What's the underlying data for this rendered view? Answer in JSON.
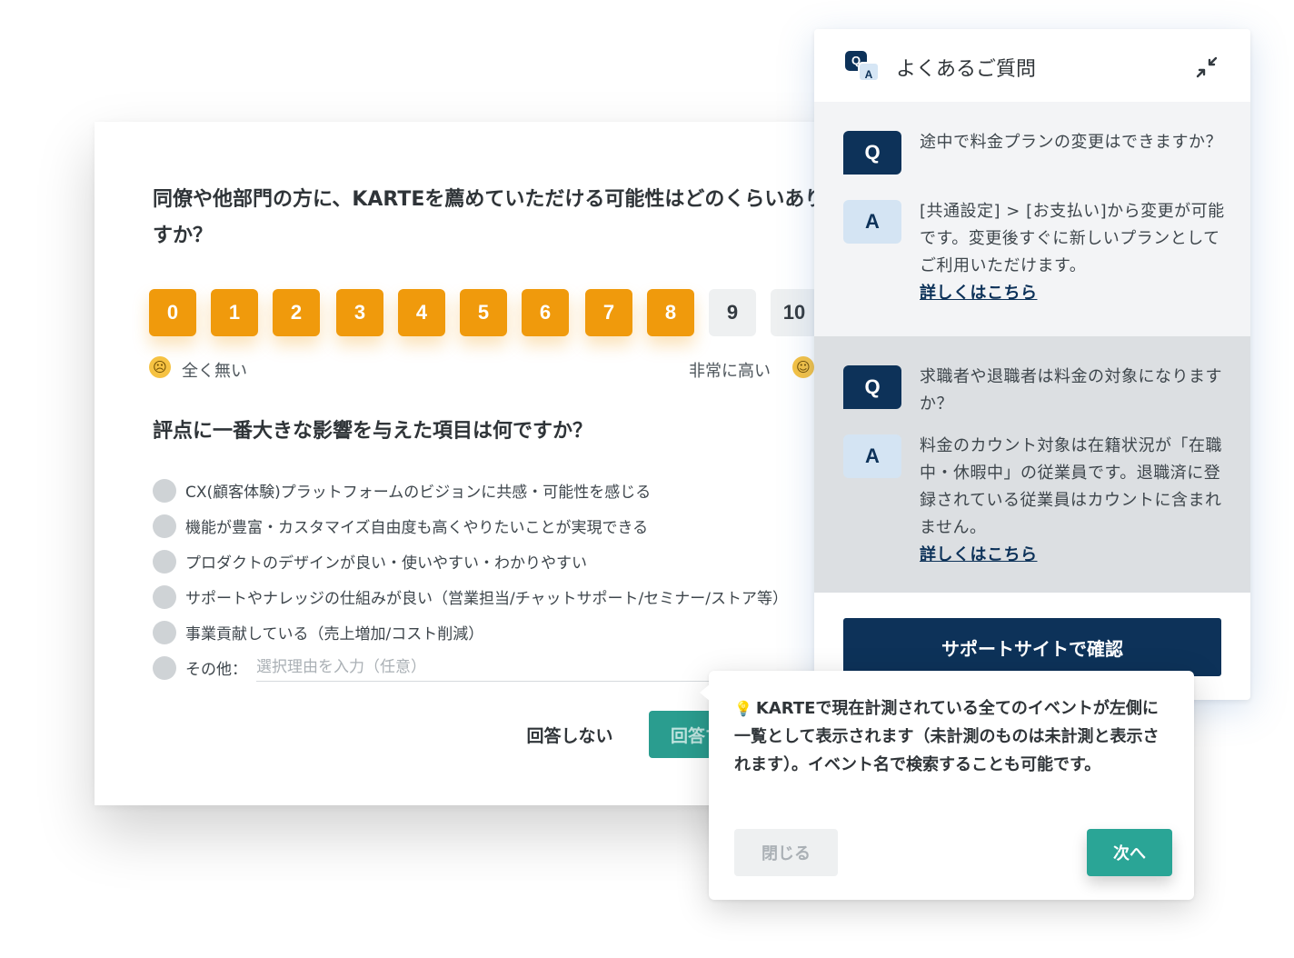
{
  "survey": {
    "question1": "同僚や他部門の方に、KARTEを薦めていただける可能性はどのくらいありますか？",
    "scale": [
      {
        "label": "0",
        "selected": true
      },
      {
        "label": "1",
        "selected": true
      },
      {
        "label": "2",
        "selected": true
      },
      {
        "label": "3",
        "selected": true
      },
      {
        "label": "4",
        "selected": true
      },
      {
        "label": "5",
        "selected": true
      },
      {
        "label": "6",
        "selected": true
      },
      {
        "label": "7",
        "selected": true
      },
      {
        "label": "8",
        "selected": true
      },
      {
        "label": "9",
        "selected": false
      },
      {
        "label": "10",
        "selected": false
      }
    ],
    "low_label": "全く無い",
    "high_label": "非常に高い",
    "question2": "評点に一番大きな影響を与えた項目は何ですか？",
    "options": [
      "CX(顧客体験)プラットフォームのビジョンに共感・可能性を感じる",
      "機能が豊富・カスタマイズ自由度も高くやりたいことが実現できる",
      "プロダクトのデザインが良い・使いやすい・わかりやすい",
      "サポートやナレッジの仕組みが良い（営業担当/チャットサポート/セミナー/ストア等）",
      "事業貢献している（売上増加/コスト削減）"
    ],
    "other_label": "その他：",
    "other_placeholder": "選択理由を入力（任意）",
    "skip_label": "回答しない",
    "submit_label": "回答する"
  },
  "faq": {
    "title": "よくあるご質問",
    "icon_q": "Q",
    "icon_a": "A",
    "items": [
      {
        "q_badge": "Q",
        "question": "途中で料金プランの変更はできますか？",
        "a_badge": "A",
        "answer": "[共通設定] > [お支払い]から変更が可能です。変更後すぐに新しいプランとしてご利用いただけます。",
        "link": "詳しくはこちら"
      },
      {
        "q_badge": "Q",
        "question": "求職者や退職者は料金の対象になりますか？",
        "a_badge": "A",
        "answer": "料金のカウント対象は在籍状況が「在職中・休暇中」の従業員です。退職済に登録されている従業員はカウントに含まれません。",
        "link": "詳しくはこちら"
      }
    ],
    "support_button": "サポートサイトで確認"
  },
  "tooltip": {
    "text": "KARTEで現在計測されている全てのイベントが左側に一覧として表示されます（未計測のものは未計測と表示されます）。イベント名で検索することも可能です。",
    "close_label": "閉じる",
    "next_label": "次へ"
  },
  "colors": {
    "scale_selected": "#f09a0c",
    "navy": "#0d3259",
    "teal": "#2aa596"
  }
}
